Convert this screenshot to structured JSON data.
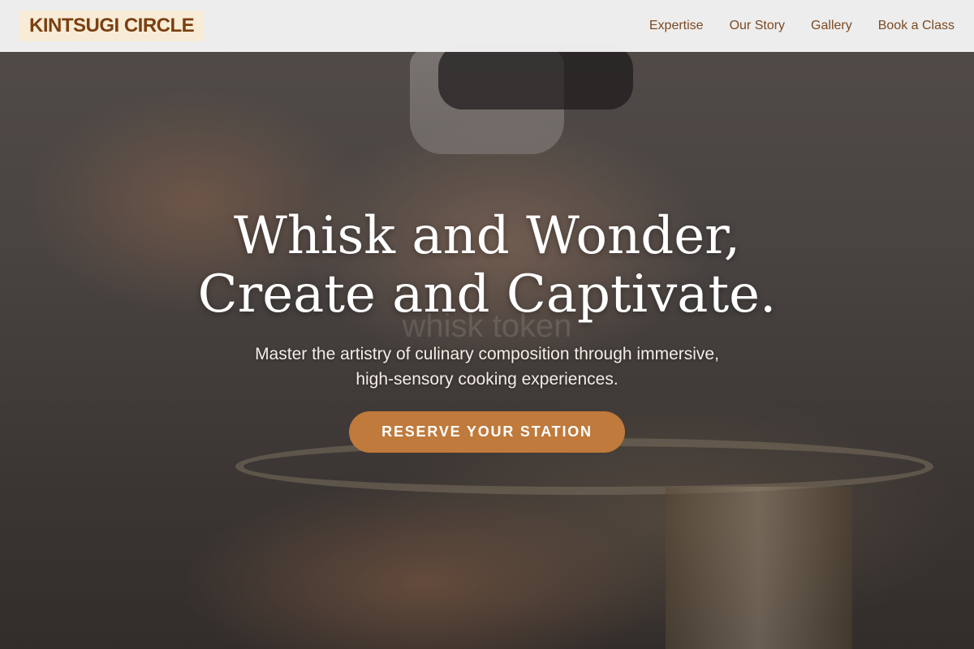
{
  "brand": {
    "logo_text": "KINTSUGI CIRCLE"
  },
  "nav": {
    "items": [
      {
        "label": "Expertise"
      },
      {
        "label": "Our Story"
      },
      {
        "label": "Gallery"
      },
      {
        "label": "Book a Class"
      }
    ]
  },
  "hero": {
    "headline_line1": "Whisk and Wonder,",
    "headline_line2": "Create and Captivate.",
    "subtext_line1": "Master the artistry of culinary composition through immersive,",
    "subtext_line2": "high-sensory cooking experiences.",
    "cta_label": "RESERVE YOUR STATION",
    "watermark_text": "whisk token"
  },
  "colors": {
    "accent": "#bf7a3c",
    "brand_text": "#7a3f12",
    "nav_text": "#7c4a22",
    "logo_bg": "#f8ecd6"
  }
}
